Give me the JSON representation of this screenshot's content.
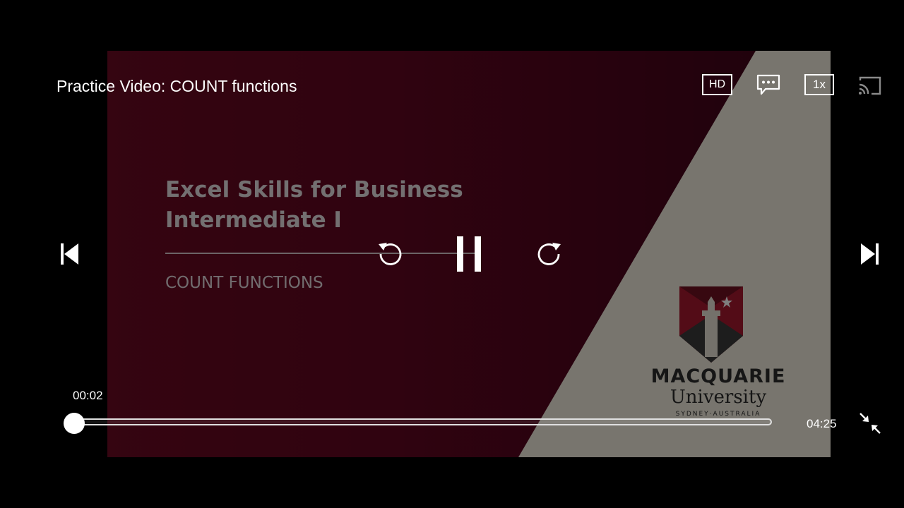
{
  "player": {
    "title": "Practice Video: COUNT functions",
    "quality_label": "HD",
    "speed_label": "1x",
    "current_time": "00:02",
    "duration": "04:25",
    "progress_fraction": 0.0,
    "icons": {
      "captions": "captions-icon",
      "cast": "cast-icon",
      "previous": "skip-previous-icon",
      "next": "skip-next-icon",
      "rewind": "replay-icon",
      "pause": "pause-icon",
      "forward": "forward-icon",
      "exit_fullscreen": "exit-fullscreen-icon"
    }
  },
  "video_frame": {
    "slide_title": "Excel Skills for Business Intermediate I",
    "slide_subtitle": "COUNT FUNCTIONS",
    "logo_name": "MACQUARIE",
    "logo_university": "University",
    "logo_location": "SYDNEY·AUSTRALIA",
    "colors": {
      "maroon": "#6a0a22",
      "cream": "#f0ebdd",
      "logo_red": "#a6192e"
    }
  }
}
